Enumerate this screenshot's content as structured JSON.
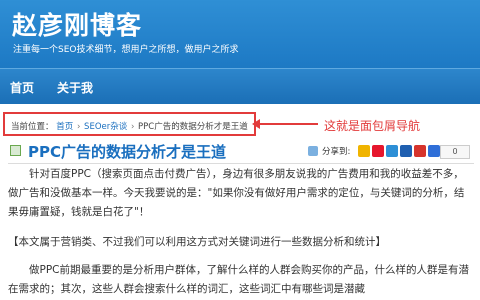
{
  "header": {
    "site_title": "赵彦刚博客",
    "tagline": "注重每一个SEO技术细节，想用户之所想，做用户之所求"
  },
  "nav": {
    "items": [
      {
        "label": "首页"
      },
      {
        "label": "关于我"
      }
    ]
  },
  "breadcrumb": {
    "prefix": "当前位置：",
    "home": "首页",
    "category": "SEOer杂谈",
    "current": "PPC广告的数据分析才是王道",
    "separator": "›"
  },
  "annotation": {
    "text": "这就是面包屑导航"
  },
  "post": {
    "title": "PPC广告的数据分析才是王道",
    "share_label": "分享到:",
    "share_count": "0",
    "share_services": [
      {
        "name": "qzone",
        "color": "#f0b400"
      },
      {
        "name": "weibo",
        "color": "#e6162d"
      },
      {
        "name": "tencent-weibo",
        "color": "#2d8fd6"
      },
      {
        "name": "renren",
        "color": "#1f5fb0"
      },
      {
        "name": "kaixin",
        "color": "#d6342c"
      },
      {
        "name": "baidu",
        "color": "#2f6fd8"
      }
    ],
    "paragraphs": [
      "针对百度PPC（搜索页面点击付费广告），身边有很多朋友说我的广告费用和我的收益差不多，做广告和没做基本一样。今天我要说的是：\"如果你没有做好用户需求的定位，与关键词的分析，结果毋庸置疑，钱就是白花了\"！",
      "【本文属于营销类、不过我们可以利用这方式对关键词进行一些数据分析和统计】",
      "做PPC前期最重要的是分析用户群体，了解什么样的人群会购买你的产品，什么样的人群是有潜在需求的；其次，这些人群会搜索什么样的词汇，这些词汇中有哪些词是潜藏"
    ]
  }
}
